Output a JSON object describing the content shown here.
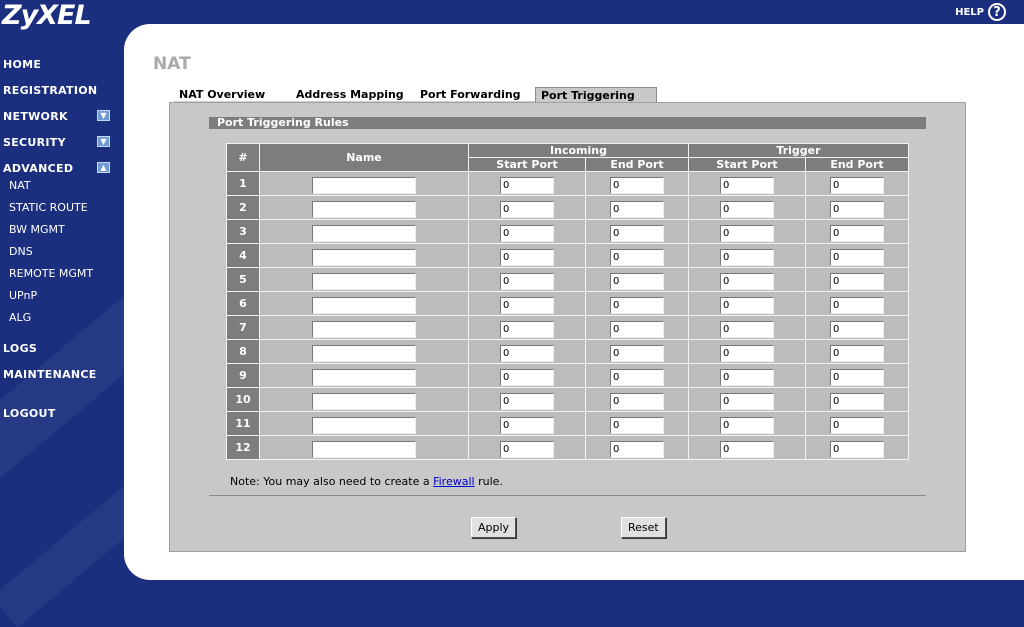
{
  "brand": {
    "logo": "ZyXEL",
    "help_label": "HELP",
    "help_icon": "question-circle-icon"
  },
  "nav": {
    "home": "HOME",
    "registration": "REGISTRATION",
    "network": "NETWORK",
    "security": "SECURITY",
    "advanced": "ADVANCED",
    "advanced_items": [
      "NAT",
      "STATIC ROUTE",
      "BW MGMT",
      "DNS",
      "REMOTE MGMT",
      "UPnP",
      "ALG"
    ],
    "logs": "LOGS",
    "maintenance": "MAINTENANCE",
    "logout": "LOGOUT"
  },
  "page": {
    "title": "NAT"
  },
  "tabs": [
    "NAT Overview",
    "Address Mapping",
    "Port Forwarding",
    "Port Triggering"
  ],
  "active_tab": "Port Triggering",
  "section": {
    "title": "Port Triggering Rules"
  },
  "table": {
    "headers": {
      "num": "#",
      "name": "Name",
      "incoming": "Incoming",
      "trigger": "Trigger",
      "start_port": "Start Port",
      "end_port": "End Port"
    },
    "rows": [
      {
        "num": "1",
        "name": "",
        "in_start": "0",
        "in_end": "0",
        "tr_start": "0",
        "tr_end": "0"
      },
      {
        "num": "2",
        "name": "",
        "in_start": "0",
        "in_end": "0",
        "tr_start": "0",
        "tr_end": "0"
      },
      {
        "num": "3",
        "name": "",
        "in_start": "0",
        "in_end": "0",
        "tr_start": "0",
        "tr_end": "0"
      },
      {
        "num": "4",
        "name": "",
        "in_start": "0",
        "in_end": "0",
        "tr_start": "0",
        "tr_end": "0"
      },
      {
        "num": "5",
        "name": "",
        "in_start": "0",
        "in_end": "0",
        "tr_start": "0",
        "tr_end": "0"
      },
      {
        "num": "6",
        "name": "",
        "in_start": "0",
        "in_end": "0",
        "tr_start": "0",
        "tr_end": "0"
      },
      {
        "num": "7",
        "name": "",
        "in_start": "0",
        "in_end": "0",
        "tr_start": "0",
        "tr_end": "0"
      },
      {
        "num": "8",
        "name": "",
        "in_start": "0",
        "in_end": "0",
        "tr_start": "0",
        "tr_end": "0"
      },
      {
        "num": "9",
        "name": "",
        "in_start": "0",
        "in_end": "0",
        "tr_start": "0",
        "tr_end": "0"
      },
      {
        "num": "10",
        "name": "",
        "in_start": "0",
        "in_end": "0",
        "tr_start": "0",
        "tr_end": "0"
      },
      {
        "num": "11",
        "name": "",
        "in_start": "0",
        "in_end": "0",
        "tr_start": "0",
        "tr_end": "0"
      },
      {
        "num": "12",
        "name": "",
        "in_start": "0",
        "in_end": "0",
        "tr_start": "0",
        "tr_end": "0"
      }
    ]
  },
  "note": {
    "prefix": "Note: You may also need to create a ",
    "link": "Firewall",
    "suffix": " rule."
  },
  "buttons": {
    "apply": "Apply",
    "reset": "Reset"
  },
  "colors": {
    "nav_bg": "#1b2f7e",
    "header_gray": "#7d7d7d",
    "panel_gray": "#c8c8c8",
    "link_blue": "#0000cc"
  }
}
